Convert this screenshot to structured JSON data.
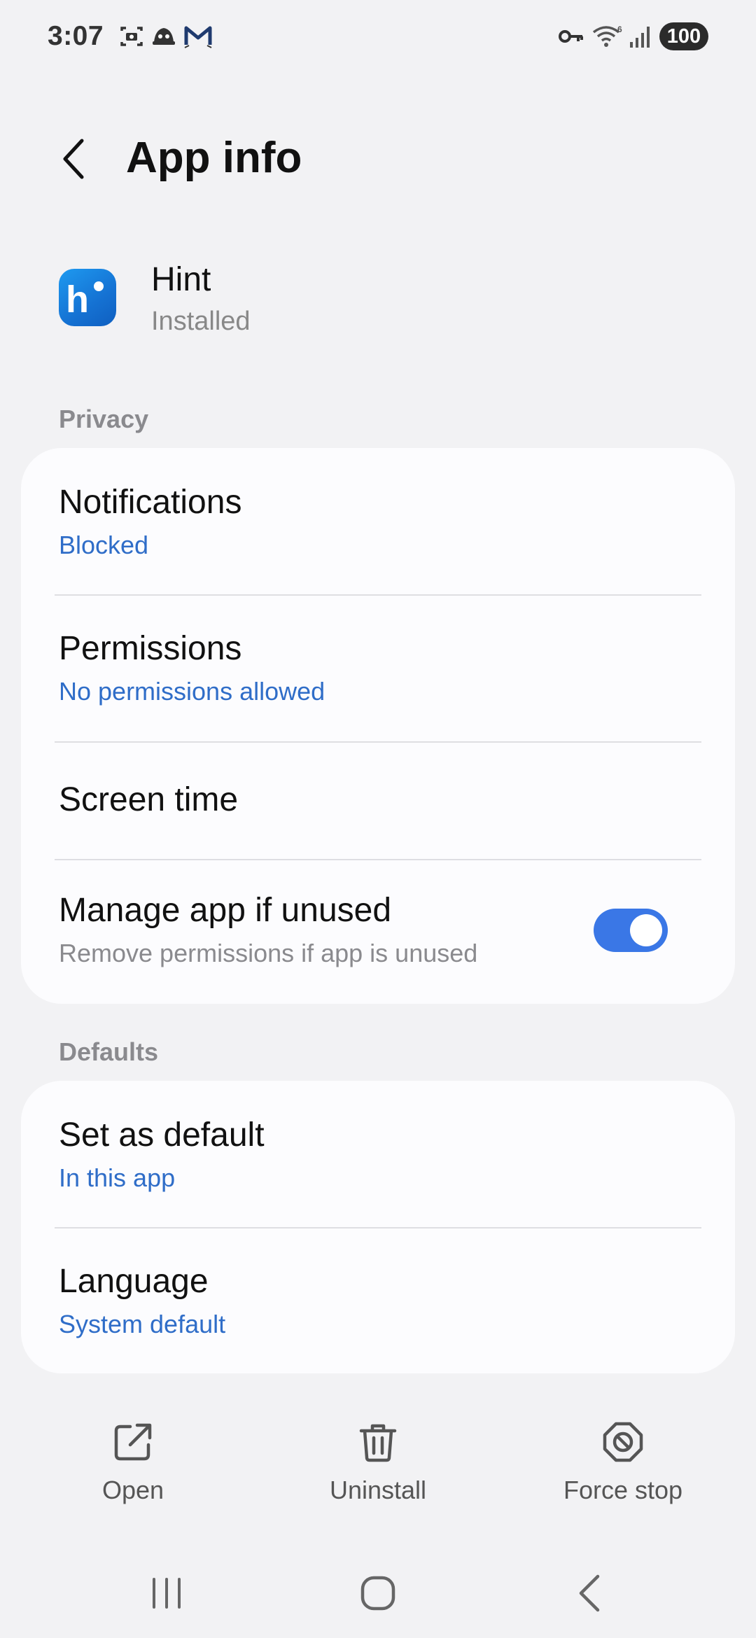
{
  "status_bar": {
    "time": "3:07",
    "battery": "100",
    "icons": [
      "screenshot-icon",
      "pokemon-go-icon",
      "gmail-icon",
      "vpn-key-icon",
      "wifi-icon",
      "signal-icon"
    ]
  },
  "header": {
    "title": "App info"
  },
  "app": {
    "name": "Hint",
    "status": "Installed",
    "icon_letter": "h",
    "icon_color": "#1a86e4"
  },
  "privacy": {
    "section_label": "Privacy",
    "notifications": {
      "title": "Notifications",
      "value": "Blocked"
    },
    "permissions": {
      "title": "Permissions",
      "value": "No permissions allowed"
    },
    "screen_time": {
      "title": "Screen time"
    },
    "manage_unused": {
      "title": "Manage app if unused",
      "subtitle": "Remove permissions if app is unused",
      "enabled": true
    }
  },
  "defaults": {
    "section_label": "Defaults",
    "set_as_default": {
      "title": "Set as default",
      "value": "In this app"
    },
    "language": {
      "title": "Language",
      "value": "System default"
    }
  },
  "actions": {
    "open": "Open",
    "uninstall": "Uninstall",
    "force_stop": "Force stop"
  },
  "colors": {
    "accent": "#2f6dc8",
    "toggle_on": "#3a77e6",
    "background": "#f2f2f4",
    "card": "#fcfcfe"
  }
}
